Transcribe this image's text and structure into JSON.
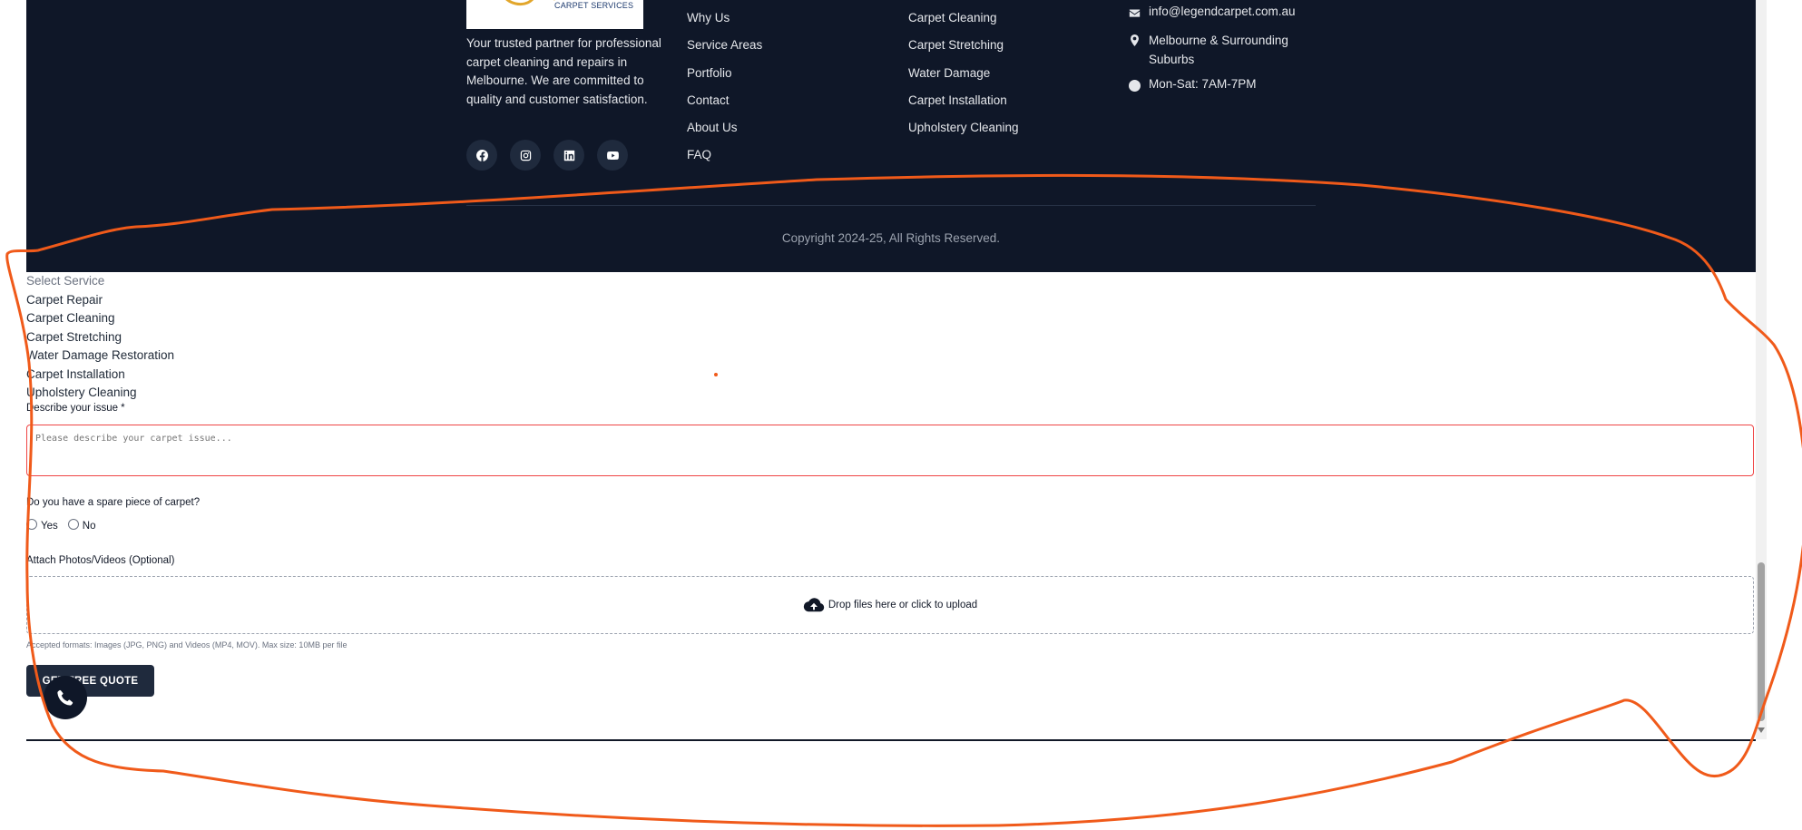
{
  "footer": {
    "logo_text": "CARPET SERVICES",
    "about": "Your trusted partner for professional carpet cleaning and repairs in Melbourne. We are committed to quality and customer satisfaction.",
    "socials": [
      "facebook-icon",
      "instagram-icon",
      "linkedin-icon",
      "youtube-icon"
    ],
    "quick_links": [
      "Why Us",
      "Service Areas",
      "Portfolio",
      "Contact",
      "About Us",
      "FAQ"
    ],
    "services": [
      "Carpet Cleaning",
      "Carpet Stretching",
      "Water Damage",
      "Carpet Installation",
      "Upholstery Cleaning"
    ],
    "contact": {
      "email": "info@legendcarpet.com.au",
      "location": "Melbourne & Surrounding Suburbs",
      "hours": "Mon-Sat: 7AM-7PM"
    },
    "copyright": "Copyright 2024-25, All Rights Reserved."
  },
  "form": {
    "service_placeholder": "Select Service",
    "service_options": [
      "Carpet Repair",
      "Carpet Cleaning",
      "Carpet Stretching",
      "Water Damage Restoration",
      "Carpet Installation",
      "Upholstery Cleaning"
    ],
    "issue_label": "Describe your issue *",
    "issue_placeholder": "Please describe your carpet issue...",
    "spare_label": "Do you have a spare piece of carpet?",
    "spare_yes": "Yes",
    "spare_no": "No",
    "attach_label": "Attach Photos/Videos (Optional)",
    "upload_text": "Drop files here or click to upload",
    "formats_note": "Accepted formats: Images (JPG, PNG) and Videos (MP4, MOV). Max size: 10MB per file",
    "submit_label": "GET FREE QUOTE"
  },
  "colors": {
    "footer_bg": "#0f1728",
    "annotation": "#f05a1a",
    "error_border": "#ef4444",
    "button_bg": "#1f2a3d"
  }
}
